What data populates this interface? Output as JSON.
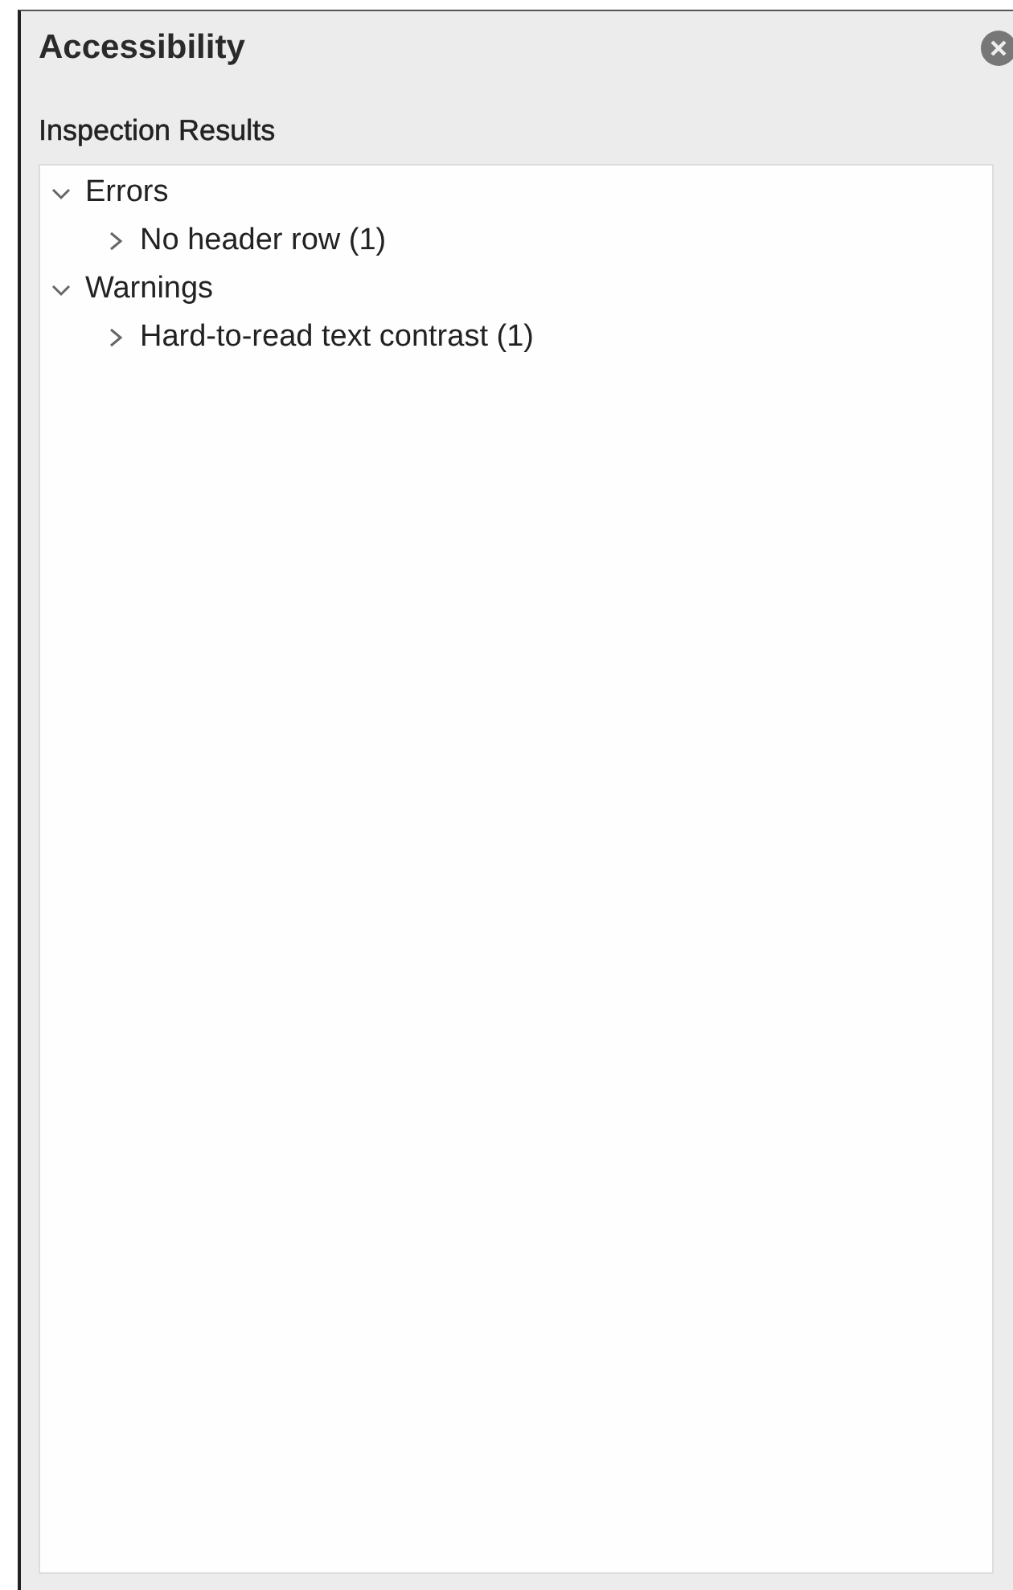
{
  "pane": {
    "title": "Accessibility"
  },
  "section": {
    "title": "Inspection Results"
  },
  "tree": [
    {
      "label": "Errors",
      "expanded": true,
      "children": [
        {
          "label": "No header row (1)",
          "expanded": false
        }
      ]
    },
    {
      "label": "Warnings",
      "expanded": true,
      "children": [
        {
          "label": "Hard-to-read text contrast (1)",
          "expanded": false
        }
      ]
    }
  ]
}
